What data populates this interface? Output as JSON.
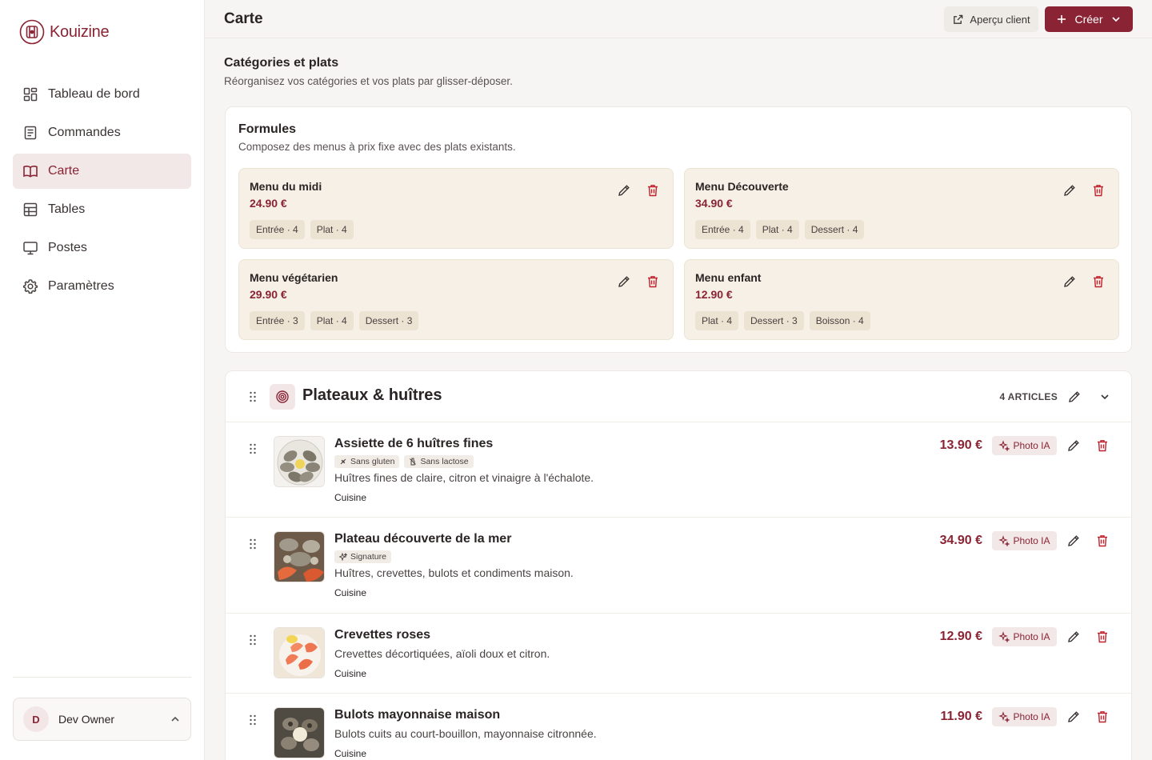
{
  "brand": {
    "name": "Kouizine",
    "accent": "#8a2434"
  },
  "sidebar": {
    "items": [
      {
        "label": "Tableau de bord",
        "icon": "dashboard-icon",
        "active": false
      },
      {
        "label": "Commandes",
        "icon": "orders-icon",
        "active": false
      },
      {
        "label": "Carte",
        "icon": "book-open-icon",
        "active": true
      },
      {
        "label": "Tables",
        "icon": "grid-icon",
        "active": false
      },
      {
        "label": "Postes",
        "icon": "monitor-icon",
        "active": false
      },
      {
        "label": "Paramètres",
        "icon": "gear-icon",
        "active": false
      }
    ],
    "user": {
      "initial": "D",
      "name": "Dev Owner"
    }
  },
  "header": {
    "title": "Carte",
    "preview_label": "Aperçu client",
    "create_label": "Créer"
  },
  "section": {
    "title": "Catégories et plats",
    "subtitle": "Réorganisez vos catégories et vos plats par glisser-déposer."
  },
  "formules": {
    "title": "Formules",
    "subtitle": "Composez des menus à prix fixe avec des plats existants.",
    "menus": [
      {
        "name": "Menu du midi",
        "price": "24.90 €",
        "tags": [
          "Entrée · 4",
          "Plat · 4"
        ]
      },
      {
        "name": "Menu Découverte",
        "price": "34.90 €",
        "tags": [
          "Entrée · 4",
          "Plat · 4",
          "Dessert · 4"
        ]
      },
      {
        "name": "Menu végétarien",
        "price": "29.90 €",
        "tags": [
          "Entrée · 3",
          "Plat · 4",
          "Dessert · 3"
        ]
      },
      {
        "name": "Menu enfant",
        "price": "12.90 €",
        "tags": [
          "Plat · 4",
          "Dessert · 3",
          "Boisson · 4"
        ]
      }
    ]
  },
  "category": {
    "name": "Plateaux & huîtres",
    "count": "4 ARTICLES",
    "photo_label": "Photo IA",
    "dishes": [
      {
        "name": "Assiette de 6 huîtres fines",
        "tags": [
          "Sans gluten",
          "Sans lactose"
        ],
        "description": "Huîtres fines de claire, citron et vinaigre à l'échalote.",
        "station": "Cuisine",
        "price": "13.90 €"
      },
      {
        "name": "Plateau découverte de la mer",
        "tags": [
          "Signature"
        ],
        "description": "Huîtres, crevettes, bulots et condiments maison.",
        "station": "Cuisine",
        "price": "34.90 €"
      },
      {
        "name": "Crevettes roses",
        "tags": [],
        "description": "Crevettes décortiquées, aïoli doux et citron.",
        "station": "Cuisine",
        "price": "12.90 €"
      },
      {
        "name": "Bulots mayonnaise maison",
        "tags": [],
        "description": "Bulots cuits au court-bouillon, mayonnaise citronnée.",
        "station": "Cuisine",
        "price": "11.90 €"
      }
    ]
  }
}
